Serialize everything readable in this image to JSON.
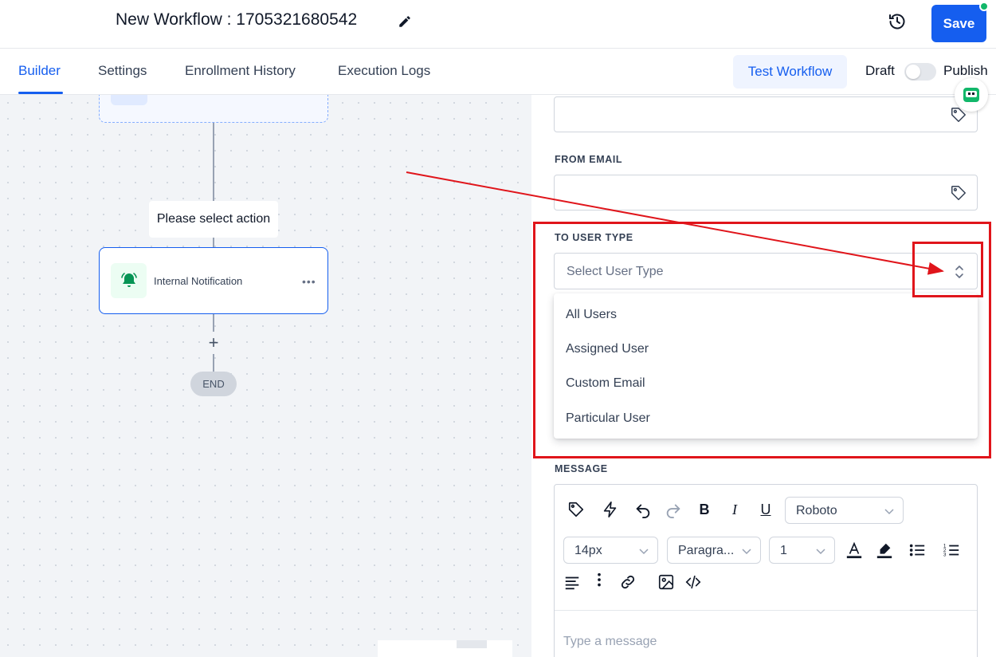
{
  "header": {
    "title": "New Workflow : 1705321680542",
    "save_label": "Save"
  },
  "tabs": [
    {
      "label": "Builder",
      "active": true
    },
    {
      "label": "Settings",
      "active": false
    },
    {
      "label": "Enrollment History",
      "active": false
    },
    {
      "label": "Execution Logs",
      "active": false
    }
  ],
  "toolbar": {
    "test_label": "Test Workflow",
    "draft_label": "Draft",
    "publish_label": "Publish",
    "published": false
  },
  "canvas": {
    "select_action_label": "Please select action",
    "action_label": "Internal Notification",
    "end_label": "END"
  },
  "panel": {
    "from_email_label": "FROM EMAIL",
    "to_user_type_label": "TO USER TYPE",
    "user_type_placeholder": "Select User Type",
    "user_type_options": [
      "All Users",
      "Assigned User",
      "Custom Email",
      "Particular User"
    ],
    "message_label": "MESSAGE",
    "font_family": "Roboto",
    "font_size": "14px",
    "block_style": "Paragra...",
    "line_height": "1",
    "message_placeholder": "Type a message"
  },
  "colors": {
    "accent": "#155eef",
    "annotation": "#e0151b",
    "success": "#12b76a"
  },
  "icons": [
    "edit-icon",
    "history-icon",
    "bell-icon",
    "more-icon",
    "tag-icon",
    "chevrons-icon",
    "lightning-icon",
    "undo-icon",
    "redo-icon",
    "bold-icon",
    "italic-icon",
    "underline-icon",
    "text-color-icon",
    "highlight-icon",
    "bullet-list-icon",
    "numbered-list-icon",
    "align-icon",
    "more-vertical-icon",
    "link-icon",
    "image-icon",
    "code-icon",
    "bot-icon"
  ]
}
